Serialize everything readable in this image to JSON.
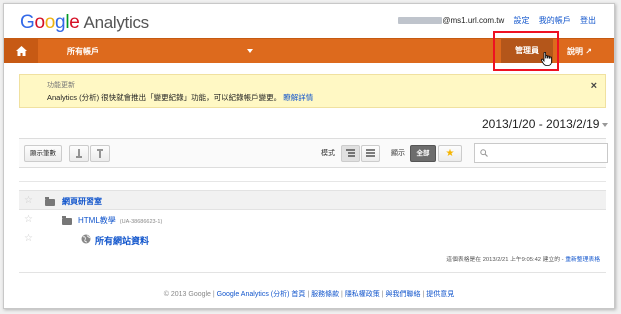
{
  "header": {
    "logo_google": "Google",
    "logo_analytics": "Analytics",
    "user_email_suffix": "@ms1.url.com.tw",
    "links": [
      "設定",
      "我的帳戶",
      "登出"
    ]
  },
  "nav": {
    "account_label": "所有帳戶",
    "admin_label": "管理員",
    "help_label": "說明",
    "color": "#dd6a1d"
  },
  "notice": {
    "title": "功能更新",
    "text": "Analytics (分析) 很快就會推出「變更紀錄」功能，可以紀錄帳戶變更。",
    "link": "瞭解詳情",
    "close": "×"
  },
  "date_range": "2013/1/20 - 2013/2/19",
  "toolbar": {
    "show_rows": "顯示筆數",
    "mode_label": "模式",
    "display_label": "顯示",
    "all_label": "全部",
    "search_placeholder": ""
  },
  "tree": {
    "group": "網頁研習室",
    "property": "HTML教學",
    "property_id": "(UA-38686623-1)",
    "profile": "所有網站資料"
  },
  "updated": {
    "text": "這個表格是在 2013/2/21 上午9:05:42 建立的 -",
    "link": "重新整理表格"
  },
  "footer": {
    "copyright": "© 2013 Google |",
    "links": [
      "Google Analytics (分析) 首頁",
      "服務條款",
      "隱私權政策",
      "與我們聯絡",
      "提供意見"
    ]
  }
}
